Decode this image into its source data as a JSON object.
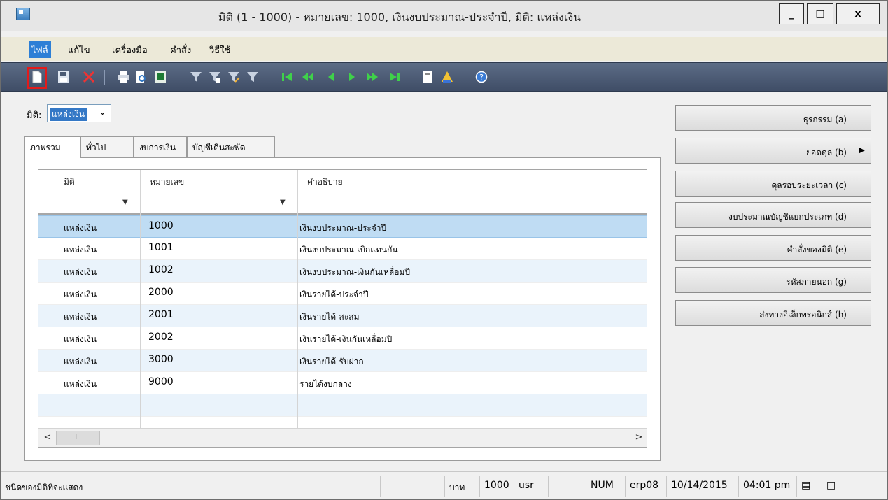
{
  "window": {
    "title": "มิติ (1 - 1000) - หมายเลข: 1000, เงินงบประมาณ-ประจำปี, มิติ: แหล่งเงิน",
    "min_label": "_",
    "max_label": "□",
    "close_label": "x"
  },
  "menu": {
    "items": [
      {
        "label": "ไฟล์"
      },
      {
        "label": "แก้ไข"
      },
      {
        "label": "เครื่องมือ"
      },
      {
        "label": "คำสั่ง"
      },
      {
        "label": "วิธีใช้"
      }
    ]
  },
  "toolbar": {
    "icons": [
      "new-icon",
      "save-icon",
      "delete-icon",
      "print-icon",
      "print-preview-icon",
      "export-excel-icon",
      "filter-icon",
      "filter-by-selection-icon",
      "advanced-filter-icon",
      "remove-filter-icon",
      "first-record-icon",
      "previous-page-icon",
      "previous-record-icon",
      "next-record-icon",
      "next-page-icon",
      "last-record-icon",
      "document-handling-icon",
      "alert-icon",
      "help-icon"
    ]
  },
  "dimension": {
    "label": "มิติ:",
    "value": "แหล่งเงิน"
  },
  "tabs": [
    {
      "label": "ภาพรวม"
    },
    {
      "label": "ทั่วไป"
    },
    {
      "label": "งบการเงิน"
    },
    {
      "label": "บัญชีเดินสะพัด"
    }
  ],
  "grid": {
    "columns": [
      "มิติ",
      "หมายเลข",
      "คำอธิบาย"
    ],
    "rows": [
      {
        "dimension": "แหล่งเงิน",
        "number": "1000",
        "description": "เงินงบประมาณ-ประจำปี"
      },
      {
        "dimension": "แหล่งเงิน",
        "number": "1001",
        "description": "เงินงบประมาณ-เบิกแทนกัน"
      },
      {
        "dimension": "แหล่งเงิน",
        "number": "1002",
        "description": "เงินงบประมาณ-เงินกันเหลื่อมปี"
      },
      {
        "dimension": "แหล่งเงิน",
        "number": "2000",
        "description": "เงินรายได้-ประจำปี"
      },
      {
        "dimension": "แหล่งเงิน",
        "number": "2001",
        "description": "เงินรายได้-สะสม"
      },
      {
        "dimension": "แหล่งเงิน",
        "number": "2002",
        "description": "เงินรายได้-เงินกันเหลื่อมปี"
      },
      {
        "dimension": "แหล่งเงิน",
        "number": "3000",
        "description": "เงินรายได้-รับฝาก"
      },
      {
        "dimension": "แหล่งเงิน",
        "number": "9000",
        "description": "รายได้งบกลาง"
      }
    ],
    "scroll_left": "<",
    "scroll_thumb": "III",
    "scroll_right": ">"
  },
  "side_buttons": [
    {
      "label": "ธุรกรรม (a)",
      "has_submenu": false
    },
    {
      "label": "ยอดดุล (b)",
      "has_submenu": true
    },
    {
      "label": "ดุลรอบระยะเวลา (c)",
      "has_submenu": false
    },
    {
      "label": "งบประมาณบัญชีแยกประเภท (d)",
      "has_submenu": false
    },
    {
      "label": "คำสั่งของมิติ (e)",
      "has_submenu": false
    },
    {
      "label": "รหัสภายนอก (g)",
      "has_submenu": false
    },
    {
      "label": "ส่งทางอิเล็กทรอนิกส์ (h)",
      "has_submenu": false
    }
  ],
  "statusbar": {
    "help_text": "ชนิดของมิติที่จะแสดง",
    "currency": "บาท",
    "company": "1000",
    "layer": "usr",
    "num": "NUM",
    "server": "erp08",
    "date": "10/14/2015",
    "time": "04:01 pm"
  },
  "colors": {
    "selection": "#bfdcf3",
    "alt_row": "#eaf3fb",
    "toolbar": "#4b5a73",
    "highlight": "#e21b1b"
  }
}
